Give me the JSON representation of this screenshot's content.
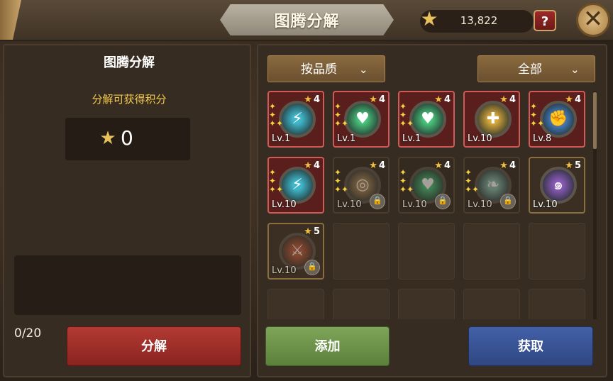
{
  "header": {
    "title": "图腾分解",
    "currency_value": "13,822",
    "help_label": "?",
    "close_label": "✕"
  },
  "left_panel": {
    "title": "图腾分解",
    "subtitle": "分解可获得积分",
    "points_value": "0",
    "counter": "0/20",
    "decompose_label": "分解"
  },
  "right_panel": {
    "quality_dropdown": "按品质",
    "filter_dropdown": "全部",
    "add_label": "添加",
    "obtain_label": "获取"
  },
  "totems": [
    {
      "stars": "4",
      "level": "Lv.1",
      "icon": "claw-icon",
      "color": "#3fb6c9",
      "style": "red",
      "locked": false,
      "sparkle": true
    },
    {
      "stars": "4",
      "level": "Lv.1",
      "icon": "heart-plus-icon",
      "color": "#4ac27a",
      "style": "red",
      "locked": false,
      "sparkle": true
    },
    {
      "stars": "4",
      "level": "Lv.1",
      "icon": "heart-plus-icon",
      "color": "#4ac27a",
      "style": "red",
      "locked": false,
      "sparkle": true
    },
    {
      "stars": "4",
      "level": "Lv.10",
      "icon": "shield-icon",
      "color": "#d8a83a",
      "style": "red",
      "locked": false,
      "sparkle": false
    },
    {
      "stars": "4",
      "level": "Lv.8",
      "icon": "fist-icon",
      "color": "#4a8ad6",
      "style": "red",
      "locked": false,
      "sparkle": true
    },
    {
      "stars": "4",
      "level": "Lv.10",
      "icon": "claw-icon",
      "color": "#3fb6c9",
      "style": "red",
      "locked": false,
      "sparkle": true
    },
    {
      "stars": "4",
      "level": "Lv.10",
      "icon": "target-icon",
      "color": "#b08a5a",
      "style": "dark",
      "locked": true,
      "sparkle": true
    },
    {
      "stars": "4",
      "level": "Lv.10",
      "icon": "heart-plus-icon",
      "color": "#4ac27a",
      "style": "dark",
      "locked": true,
      "sparkle": true
    },
    {
      "stars": "4",
      "level": "Lv.10",
      "icon": "feather-icon",
      "color": "#8ac0b0",
      "style": "dark",
      "locked": true,
      "sparkle": true
    },
    {
      "stars": "5",
      "level": "Lv.10",
      "icon": "vortex-icon",
      "color": "#8a5ab8",
      "style": "gold",
      "locked": false,
      "sparkle": false
    },
    {
      "stars": "5",
      "level": "Lv.10",
      "icon": "sword-icon",
      "color": "#c45a3a",
      "style": "gold",
      "locked": true,
      "sparkle": false
    }
  ],
  "icon_glyphs": {
    "claw-icon": "⚡",
    "heart-plus-icon": "♥",
    "shield-icon": "✚",
    "fist-icon": "✊",
    "target-icon": "◎",
    "feather-icon": "❧",
    "vortex-icon": "๑",
    "sword-icon": "⚔"
  }
}
